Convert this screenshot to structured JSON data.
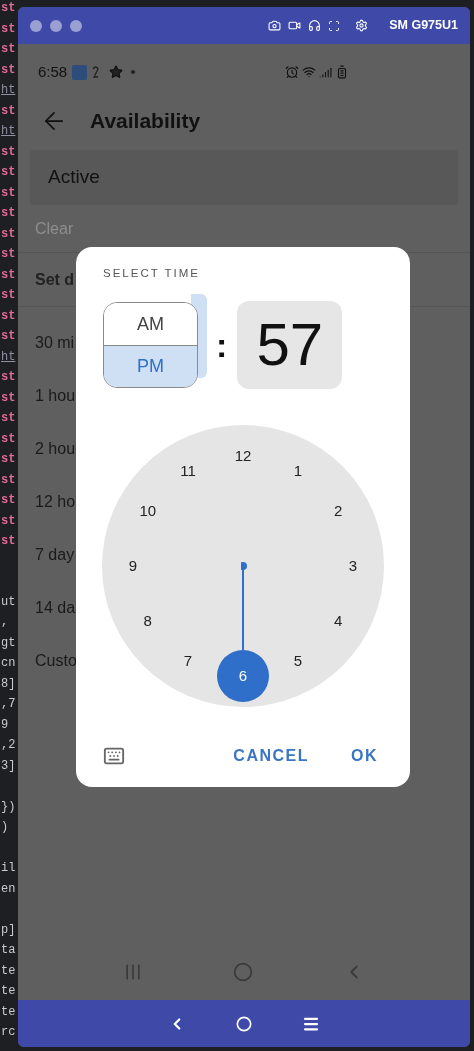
{
  "code_editor": {
    "upper_lines": [
      {
        "text": "st",
        "kind": "keyword"
      },
      {
        "text": "st",
        "kind": "keyword"
      },
      {
        "text": "st",
        "kind": "keyword"
      },
      {
        "text": "st",
        "kind": "keyword"
      },
      {
        "text": "ht",
        "kind": "link"
      },
      {
        "text": "st",
        "kind": "keyword"
      },
      {
        "text": "ht",
        "kind": "link"
      },
      {
        "text": "st",
        "kind": "keyword"
      },
      {
        "text": "st",
        "kind": "keyword"
      },
      {
        "text": "st",
        "kind": "keyword"
      },
      {
        "text": "st",
        "kind": "keyword"
      },
      {
        "text": "st",
        "kind": "keyword"
      },
      {
        "text": "st",
        "kind": "keyword"
      },
      {
        "text": "st",
        "kind": "keyword"
      },
      {
        "text": "st",
        "kind": "keyword"
      },
      {
        "text": "st",
        "kind": "keyword"
      },
      {
        "text": "st",
        "kind": "keyword"
      },
      {
        "text": "ht",
        "kind": "link"
      },
      {
        "text": "st",
        "kind": "keyword"
      },
      {
        "text": "st",
        "kind": "keyword"
      },
      {
        "text": "st",
        "kind": "keyword"
      },
      {
        "text": "st",
        "kind": "keyword"
      },
      {
        "text": "st",
        "kind": "keyword"
      },
      {
        "text": "st",
        "kind": "keyword"
      },
      {
        "text": "st",
        "kind": "keyword"
      },
      {
        "text": "st",
        "kind": "keyword"
      },
      {
        "text": "st",
        "kind": "keyword"
      }
    ],
    "lower_lines": [
      {
        "text": "ut",
        "kind": "plain"
      },
      {
        "text": ", ",
        "kind": "plain"
      },
      {
        "text": "gt",
        "kind": "plain"
      },
      {
        "text": "cn",
        "kind": "plain"
      },
      {
        "text": "8]",
        "kind": "plain"
      },
      {
        "text": ",7",
        "kind": "plain"
      },
      {
        "text": "9",
        "kind": "plain"
      },
      {
        "text": ",2",
        "kind": "plain"
      },
      {
        "text": "3]",
        "kind": "plain"
      },
      {
        "kind": "blank"
      },
      {
        "text": "})",
        "kind": "plain"
      },
      {
        "text": ")",
        "kind": "plain"
      },
      {
        "kind": "blank"
      },
      {
        "text": "il",
        "kind": "plain"
      },
      {
        "text": "en",
        "kind": "plain"
      },
      {
        "kind": "blank"
      },
      {
        "text": "p]",
        "kind": "plain"
      },
      {
        "text": "ta",
        "kind": "plain"
      },
      {
        "text": "te",
        "kind": "plain"
      },
      {
        "text": "te",
        "kind": "plain"
      },
      {
        "text": "te",
        "kind": "plain"
      },
      {
        "text": "rc",
        "kind": "plain"
      }
    ]
  },
  "emulator": {
    "title": "SM G975U1"
  },
  "phone": {
    "status_bar": {
      "time": "6:58"
    },
    "app_bar": {
      "title": "Availability"
    },
    "status_field": {
      "value": "Active"
    },
    "clear_link": "Clear",
    "section_header": "Set d",
    "options": [
      "30 mi",
      "1 hou",
      "2 hou",
      "12 ho",
      "7 day",
      "14 da",
      "Custo"
    ]
  },
  "dialog": {
    "header": "SELECT TIME",
    "periods": [
      {
        "label": "AM",
        "selected": false
      },
      {
        "label": "PM",
        "selected": true
      }
    ],
    "separator": ":",
    "minutes": "57",
    "clock": [
      {
        "label": "12",
        "selected": false
      },
      {
        "label": "1",
        "selected": false
      },
      {
        "label": "2",
        "selected": false
      },
      {
        "label": "3",
        "selected": false
      },
      {
        "label": "4",
        "selected": false
      },
      {
        "label": "5",
        "selected": false
      },
      {
        "label": "6",
        "selected": true
      },
      {
        "label": "7",
        "selected": false
      },
      {
        "label": "8",
        "selected": false
      },
      {
        "label": "9",
        "selected": false
      },
      {
        "label": "10",
        "selected": false
      },
      {
        "label": "11",
        "selected": false
      }
    ],
    "buttons": [
      {
        "label": "CANCEL"
      },
      {
        "label": "OK"
      }
    ]
  }
}
